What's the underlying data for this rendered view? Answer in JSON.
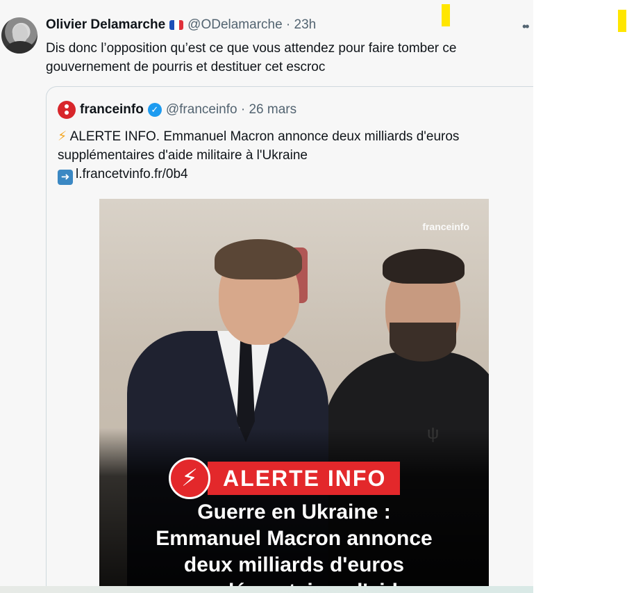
{
  "tweet": {
    "author_name": "Olivier Delamarche",
    "handle_time": "@ODelamarche · 23h",
    "text": "Dis donc l’opposition qu’est ce que vous attendez pour faire tomber ce gouvernement de pourris et destituer cet escroc"
  },
  "quoted": {
    "author_name": "franceinfo",
    "handle_time": "@franceinfo · 26 mars",
    "text_line": "ALERTE INFO. Emmanuel Macron annonce deux milliards d'euros supplémentaires d'aide militaire à l'Ukraine",
    "link": "l.francetvinfo.fr/0b4",
    "image": {
      "watermark": "franceinfo",
      "alert_label": "ALERTE INFO",
      "headline_1": "Guerre en Ukraine :",
      "headline_2": "Emmanuel Macron annonce",
      "headline_3": "deux milliards d'euros",
      "headline_4": "supplémentaires d'aide"
    }
  },
  "icons": {
    "more": "more-dots-icon",
    "flag": "france-flag-icon",
    "verified": "verified-badge-icon",
    "bolt": "lightning-icon",
    "arrow": "right-arrow-icon"
  },
  "colors": {
    "link_blue": "#1d9bf0",
    "alert_red": "#e3282b",
    "marker_yellow": "#ffe600"
  }
}
